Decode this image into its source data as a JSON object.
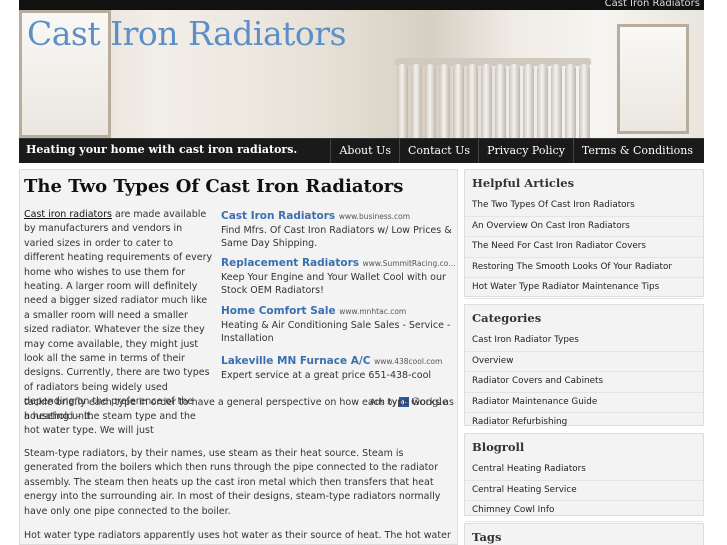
{
  "top_strip": {
    "label": "Cast Iron Radiators"
  },
  "header": {
    "site_title": "Cast Iron Radiators",
    "tagline": "Heating your home with cast iron radiators."
  },
  "nav": {
    "items": [
      {
        "label": "About Us"
      },
      {
        "label": "Contact Us"
      },
      {
        "label": "Privacy Policy"
      },
      {
        "label": "Terms & Conditions"
      }
    ]
  },
  "post": {
    "title": "The Two Types Of Cast Iron Radiators",
    "intro_link": "Cast iron radiators",
    "intro_text": " are made available by manufacturers and vendors in varied sizes in order to cater to different heating requirements of every home who wishes to use them for heating. A larger room will definitely need a bigger sized radiator much like a smaller room will need a smaller sized radiator. Whatever the size they may come available, they might just look all the same in terms of their designs. Currently, there are two types of radiators being widely used depending on the preference of the household – the steam type and the hot water type. We will just",
    "intro_tail": "tackle briefly each type in order to have a general perspective on how each type works as a heating unit.",
    "para2": "Steam-type radiators, by their names, use steam as their heat source. Steam is generated from the boilers which then runs through the pipe connected to the radiator assembly. The steam then heats up the cast iron metal which then transfers that heat energy into the surrounding air. In most of their designs, steam-type radiators normally have only one pipe connected to the boiler.",
    "para3": "Hot water type radiators apparently uses hot water as their source of heat. The hot water is"
  },
  "ads": {
    "items": [
      {
        "title": "Cast Iron Radiators",
        "url": "www.business.com",
        "text": "Find Mfrs. Of Cast Iron Radiators w/ Low Prices & Same Day Shipping."
      },
      {
        "title": "Replacement Radiators",
        "url": "www.SummitRacing.co...",
        "text": "Keep Your Engine and Your Wallet Cool with our Stock OEM Radiators!"
      },
      {
        "title": "Home Comfort Sale",
        "url": "www.mnhtac.com",
        "text": "Heating & Air Conditioning Sale Sales - Service - Installation"
      },
      {
        "title": "Lakeville MN Furnace A/C",
        "url": "www.438cool.com",
        "text": "Expert service at a great price 651-438-cool"
      }
    ],
    "ads_by": "Ads by",
    "google": "Google"
  },
  "sidebar": {
    "helpful": {
      "heading": "Helpful Articles",
      "items": [
        "The Two Types Of Cast Iron Radiators",
        "An Overview On Cast Iron Radiators",
        "The Need For Cast Iron Radiator Covers",
        "Restoring The Smooth Looks Of Your Radiator",
        "Hot Water Type Radiator Maintenance Tips"
      ]
    },
    "categories": {
      "heading": "Categories",
      "items": [
        "Cast Iron Radiator Types",
        "Overview",
        "Radiator Covers and Cabinets",
        "Radiator Maintenance Guide",
        "Radiator Refurbishing"
      ]
    },
    "blogroll": {
      "heading": "Blogroll",
      "items": [
        "Central Heating Radiators",
        "Central Heating Service",
        "Chimney Cowl Info"
      ]
    },
    "tags": {
      "heading": "Tags"
    }
  },
  "colors": {
    "title_blue": "#5c8fc8",
    "ad_blue": "#3b6fb0",
    "nav_bg": "#1a1a1a"
  },
  "icons": {
    "adchoices": "play-triangle-icon"
  }
}
